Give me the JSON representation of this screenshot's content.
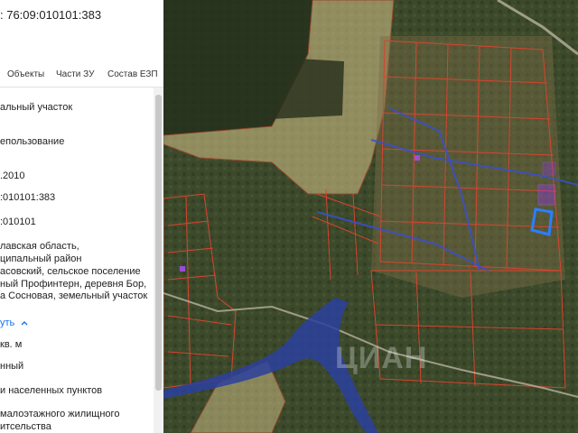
{
  "panel": {
    "title": ": 76:09:010101:383",
    "tabs": [
      {
        "label": "Объекты"
      },
      {
        "label": "Части ЗУ"
      },
      {
        "label": "Состав ЕЗП"
      }
    ],
    "info": {
      "type": "альный участок",
      "usage": "епользование",
      "date": ".2010",
      "cad_number": ":010101:383",
      "quarter": ":010101",
      "address_lines": [
        "лавская область,",
        "ципальный район",
        "асовский, сельское поселение",
        "ный Профинтерн, деревня Бор,",
        "а Сосновая, земельный участок"
      ],
      "collapse_link": "уть",
      "area": "кв. м",
      "status": "нный",
      "category": "и населенных пунктов",
      "permitted_use_lines": [
        "малоэтажного жилищного",
        "итсельства"
      ]
    }
  },
  "map": {
    "watermark": "ЦИАН",
    "colors": {
      "forest": "#3d4a2c",
      "field": "#8a7d52",
      "parcel_line": "#d9442e",
      "highlight": "#9933ff",
      "selected": "#2b7fff",
      "river": "#2c3f9e",
      "zone": "#d8c58b"
    }
  }
}
